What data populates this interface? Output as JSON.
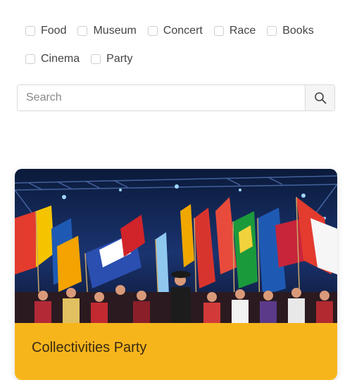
{
  "filters": {
    "row1": [
      {
        "label": "Food"
      },
      {
        "label": "Museum"
      },
      {
        "label": "Concert"
      },
      {
        "label": "Race"
      },
      {
        "label": "Books"
      }
    ],
    "row2": [
      {
        "label": "Cinema"
      },
      {
        "label": "Party"
      }
    ]
  },
  "search": {
    "placeholder": "Search",
    "button_icon": "search-icon"
  },
  "card": {
    "title": "Collectivities Party",
    "image_icon": "event-photo-flags-crowd",
    "accent_color": "#f7b51c"
  }
}
